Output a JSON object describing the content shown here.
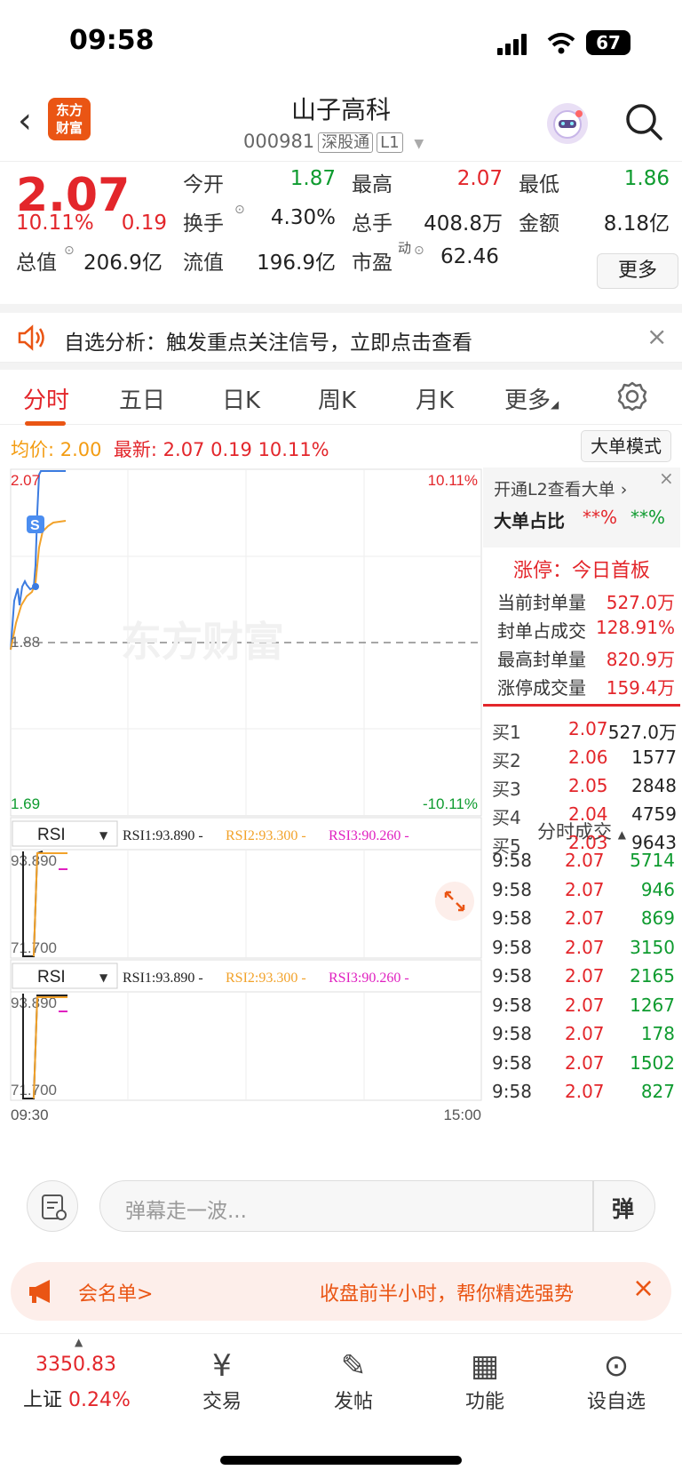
{
  "status": {
    "time": "09:58",
    "battery": "67"
  },
  "header": {
    "name": "山子高科",
    "code": "000981",
    "tag1": "深股通",
    "tag2": "L1",
    "logo": "东方财富"
  },
  "quote": {
    "price": "2.07",
    "pct": "10.11%",
    "chg": "0.19",
    "open_l": "今开",
    "open": "1.87",
    "high_l": "最高",
    "high": "2.07",
    "low_l": "最低",
    "low": "1.86",
    "turn_l": "换手",
    "turn": "4.30%",
    "vol_l": "总手",
    "vol": "408.8万",
    "amt_l": "金额",
    "amt": "8.18亿",
    "mcap_l": "总值",
    "mcap": "206.9亿",
    "fcap_l": "流值",
    "fcap": "196.9亿",
    "pe_l": "市盈",
    "pe_sup": "动",
    "pe": "62.46",
    "more": "更多"
  },
  "notice": {
    "text": "自选分析：触发重点关注信号，立即点击查看"
  },
  "tabs": [
    "分时",
    "五日",
    "日K",
    "周K",
    "月K",
    "更多"
  ],
  "chart_info": {
    "avg_l": "均价:",
    "avg": "2.00",
    "last_l": "最新:",
    "last": "2.07",
    "chg": "0.19",
    "pct": "10.11%",
    "bigorder": "大单模式"
  },
  "chart_labels": {
    "top": "2.07",
    "top_pct": "10.11%",
    "mid": "1.88",
    "bot": "1.69",
    "bot_pct": "-10.11%",
    "watermark": "东方财富",
    "s_marker": "S",
    "rsi_sel": "RSI",
    "rsi1": "RSI1:93.890 -",
    "rsi2": "RSI2:93.300 -",
    "rsi3": "RSI3:90.260 -",
    "rsi_hi": "93.890",
    "rsi_lo": "71.700",
    "t_start": "09:30",
    "t_end": "15:00"
  },
  "panel": {
    "l2": "开通L2查看大单 ›",
    "ratio_l": "大单占比",
    "ratio1": "**%",
    "ratio2": "**%",
    "limit": "涨停：今日首板",
    "rows": [
      {
        "k": "当前封单量",
        "v": "527.0万"
      },
      {
        "k": "封单占成交",
        "v": "128.91%"
      },
      {
        "k": "最高封单量",
        "v": "820.9万"
      },
      {
        "k": "涨停成交量",
        "v": "159.4万"
      }
    ],
    "bids": [
      {
        "k": "买1",
        "p": "2.07",
        "v": "527.0万"
      },
      {
        "k": "买2",
        "p": "2.06",
        "v": "1577"
      },
      {
        "k": "买3",
        "p": "2.05",
        "v": "2848"
      },
      {
        "k": "买4",
        "p": "2.04",
        "v": "4759"
      },
      {
        "k": "买5",
        "p": "2.03",
        "v": "9643"
      }
    ],
    "ticks_title": "分时成交",
    "ticks": [
      {
        "t": "9:58",
        "p": "2.07",
        "v": "5714"
      },
      {
        "t": "9:58",
        "p": "2.07",
        "v": "946"
      },
      {
        "t": "9:58",
        "p": "2.07",
        "v": "869"
      },
      {
        "t": "9:58",
        "p": "2.07",
        "v": "3150"
      },
      {
        "t": "9:58",
        "p": "2.07",
        "v": "2165"
      },
      {
        "t": "9:58",
        "p": "2.07",
        "v": "1267"
      },
      {
        "t": "9:58",
        "p": "2.07",
        "v": "178"
      },
      {
        "t": "9:58",
        "p": "2.07",
        "v": "1502"
      },
      {
        "t": "9:58",
        "p": "2.07",
        "v": "827"
      }
    ]
  },
  "comment": {
    "placeholder": "弹幕走一波...",
    "send": "弹"
  },
  "banner": {
    "left": "会名单>",
    "right": "收盘前半小时，帮你精选强势"
  },
  "nav": {
    "index_val": "3350.83",
    "index_name": "上证",
    "index_pct": "0.24%",
    "items": [
      "交易",
      "发帖",
      "功能",
      "设自选"
    ]
  }
}
